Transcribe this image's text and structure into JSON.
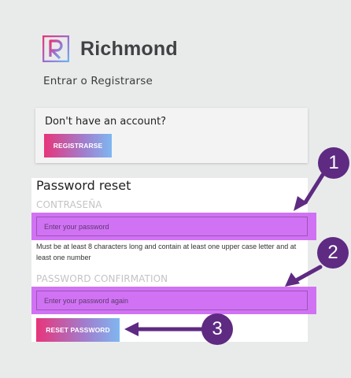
{
  "header": {
    "brand": "Richmond",
    "subtitle": "Entrar o Registrarse"
  },
  "signup": {
    "question": "Don't have an account?",
    "register_label": "REGISTRARSE"
  },
  "reset": {
    "title": "Password reset",
    "password_label": "CONTRASEÑA",
    "password_placeholder": "Enter your password",
    "help_text": "Must be at least 8 characters long and contain at least one upper case letter and at least one number",
    "confirm_label": "PASSWORD CONFIRMATION",
    "confirm_placeholder": "Enter your password again",
    "submit_label": "RESET PASSWORD"
  },
  "callouts": [
    "1",
    "2",
    "3"
  ],
  "colors": {
    "callout": "#5e2a82",
    "highlight": "#cf6af3",
    "button_gradient_start": "#e7357a",
    "button_gradient_end": "#7fb7f0",
    "background": "#e9ebea"
  }
}
